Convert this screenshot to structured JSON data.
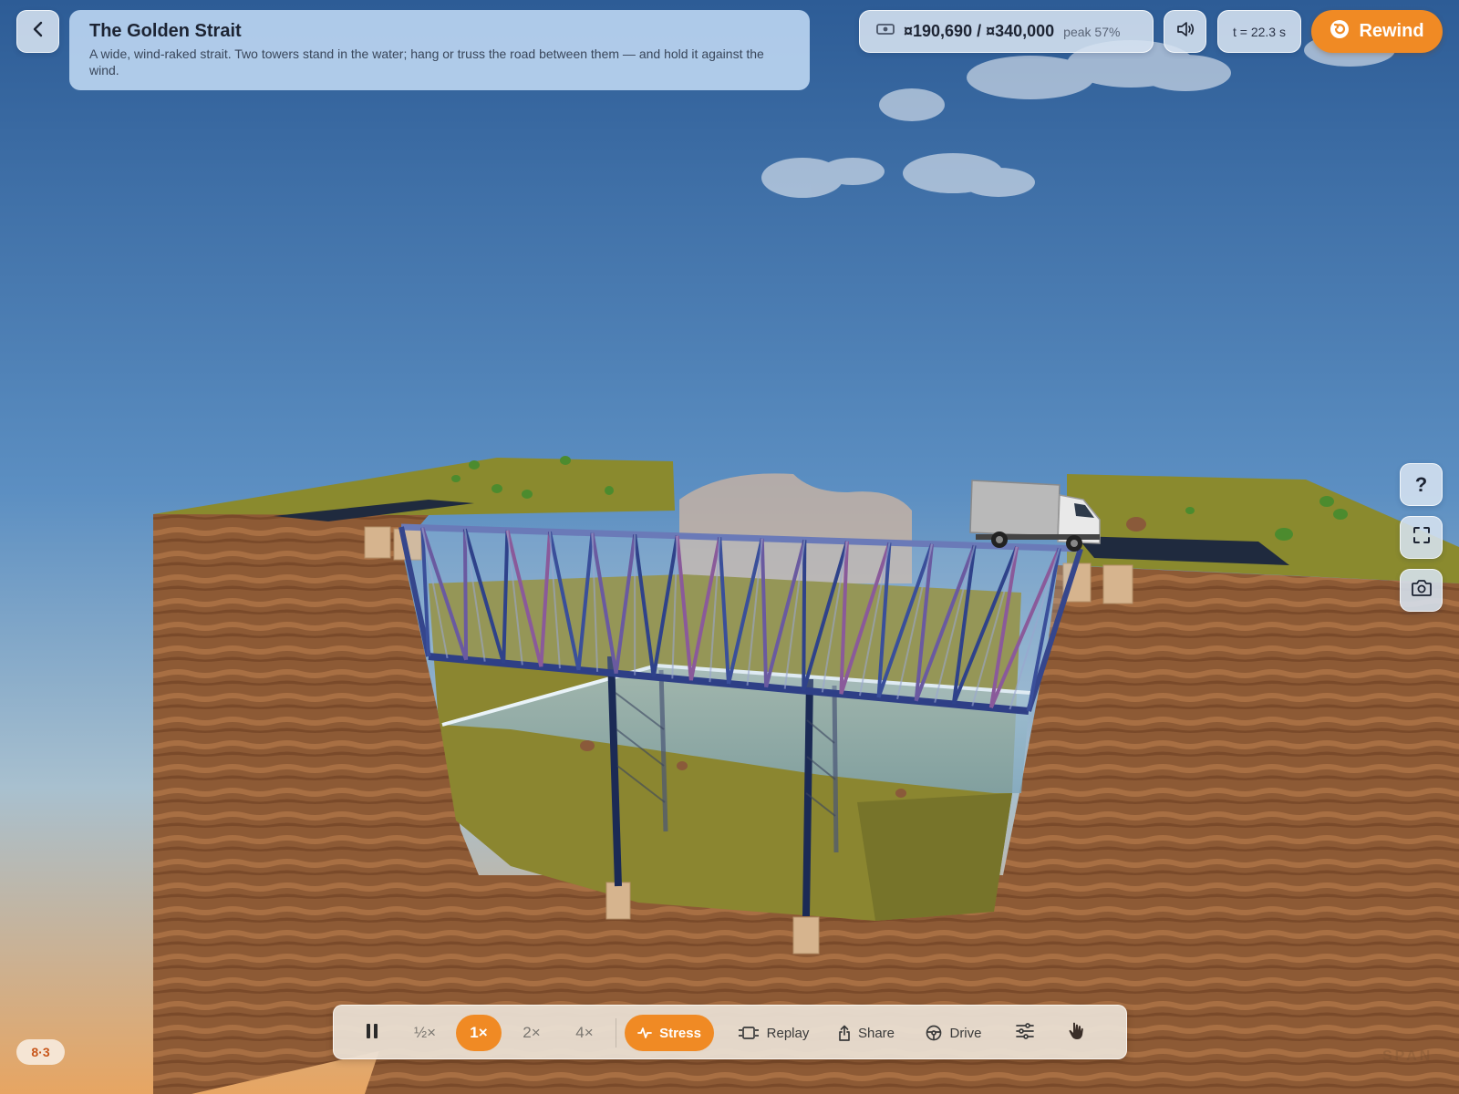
{
  "header": {
    "back_icon": "chevron-left-icon",
    "title": "The Golden Strait",
    "description": "A wide, wind-raked strait. Two towers stand in the water; hang or truss the road between them — and hold it against the wind."
  },
  "status": {
    "budget_icon": "cash-icon",
    "budget_text": "¤190,690 / ¤340,000",
    "peak_text": "peak 57%",
    "time_text": "t = 22.3 s"
  },
  "controls": {
    "sound_icon": "speaker-icon",
    "rewind_label": "Rewind",
    "rewind_icon": "rewind-icon"
  },
  "side_tools": {
    "help_label": "?",
    "fullscreen_icon": "fullscreen-icon",
    "camera_icon": "camera-icon"
  },
  "toolbar": {
    "pause_icon": "pause-icon",
    "speeds": [
      "½×",
      "1×",
      "2×",
      "4×"
    ],
    "active_speed": "1×",
    "stress_label": "Stress",
    "replay_label": "Replay",
    "share_label": "Share",
    "drive_label": "Drive",
    "settings_icon": "sliders-icon",
    "hand_icon": "hand-pointer-icon"
  },
  "level_badge": "8·3",
  "watermark": "SPAN",
  "colors": {
    "accent": "#f08a24",
    "sky_top": "#2f5f98",
    "truss": "#3a4f9a",
    "water": "#8fb3c8"
  }
}
